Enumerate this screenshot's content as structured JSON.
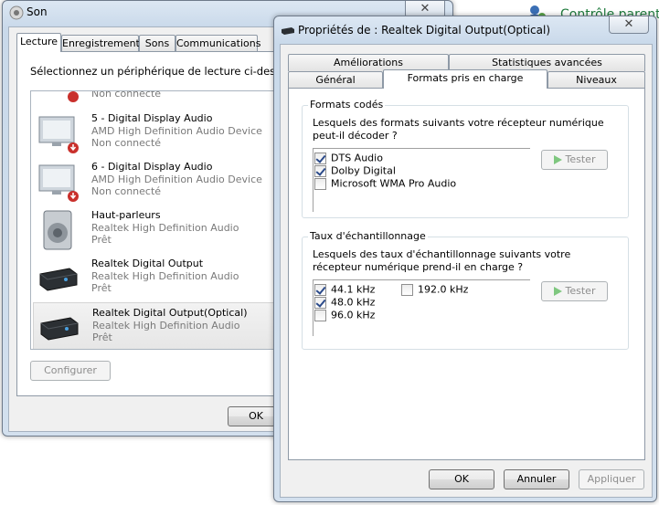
{
  "background": {
    "control_panel_link": "Contrôle parent"
  },
  "sound_window": {
    "title": "Son",
    "tabs": [
      "Lecture",
      "Enregistrement",
      "Sons",
      "Communications"
    ],
    "instruction": "Sélectionnez un périphérique de lecture ci-dessous p",
    "devices": [
      {
        "name": "",
        "driver": "",
        "status": "Non connecté",
        "icon": "monitor-icon"
      },
      {
        "name": "5 - Digital Display Audio",
        "driver": "AMD High Definition Audio Device",
        "status": "Non connecté",
        "icon": "monitor-icon"
      },
      {
        "name": "6 - Digital Display Audio",
        "driver": "AMD High Definition Audio Device",
        "status": "Non connecté",
        "icon": "monitor-icon"
      },
      {
        "name": "Haut-parleurs",
        "driver": "Realtek High Definition Audio",
        "status": "Prêt",
        "icon": "speaker-icon"
      },
      {
        "name": "Realtek Digital Output",
        "driver": "Realtek High Definition Audio",
        "status": "Prêt",
        "icon": "receiver-icon"
      },
      {
        "name": "Realtek Digital Output(Optical)",
        "driver": "Realtek High Definition Audio",
        "status": "Prêt",
        "icon": "receiver-icon"
      }
    ],
    "configure_label": "Configurer",
    "ok_label": "OK"
  },
  "props_window": {
    "title": "Propriétés de : Realtek Digital Output(Optical)",
    "tabs_row1": [
      "Améliorations",
      "Statistiques avancées"
    ],
    "tabs_row2": [
      "Général",
      "Formats pris en charge",
      "Niveaux"
    ],
    "encoded_formats": {
      "label": "Formats codés",
      "question": "Lesquels des formats suivants votre récepteur numérique peut-il décoder ?",
      "items": [
        {
          "label": "DTS Audio",
          "checked": true
        },
        {
          "label": "Dolby Digital",
          "checked": true
        },
        {
          "label": "Microsoft WMA Pro Audio",
          "checked": false
        }
      ],
      "test_label": "Tester"
    },
    "sample_rates": {
      "label": "Taux d'échantillonnage",
      "question": "Lesquels des taux d'échantillonnage suivants votre récepteur numérique prend-il en charge ?",
      "items": [
        {
          "label": "44.1 kHz",
          "checked": true
        },
        {
          "label": "48.0 kHz",
          "checked": true
        },
        {
          "label": "96.0 kHz",
          "checked": false
        },
        {
          "label": "192.0 kHz",
          "checked": false
        }
      ],
      "test_label": "Tester"
    },
    "buttons": {
      "ok": "OK",
      "cancel": "Annuler",
      "apply": "Appliquer"
    }
  }
}
